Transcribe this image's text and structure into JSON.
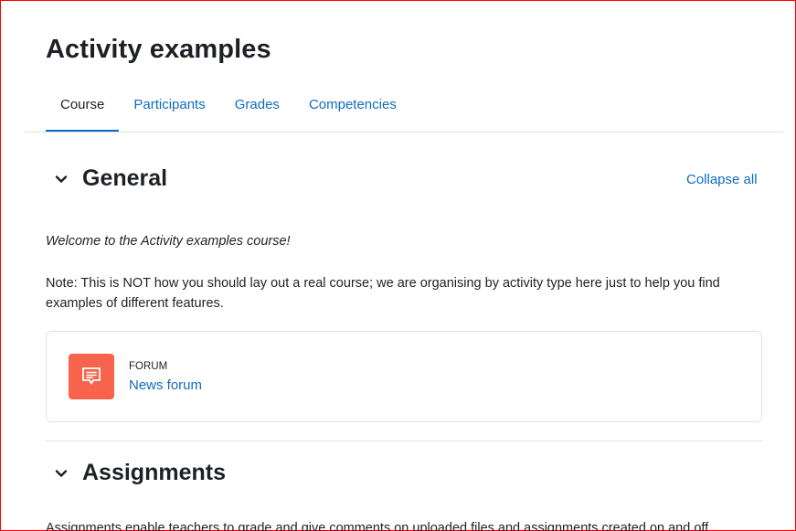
{
  "page": {
    "title": "Activity examples"
  },
  "tabs": [
    {
      "label": "Course",
      "active": true
    },
    {
      "label": "Participants",
      "active": false
    },
    {
      "label": "Grades",
      "active": false
    },
    {
      "label": "Competencies",
      "active": false
    }
  ],
  "controls": {
    "collapse_all": "Collapse all"
  },
  "sections": {
    "general": {
      "title": "General",
      "welcome": "Welcome to the Activity examples course!",
      "note": "Note: This is NOT how you should lay out a real course; we are organising by activity type here just to help you find examples of different features.",
      "activity": {
        "type": "FORUM",
        "name": "News forum",
        "icon": "forum-icon"
      }
    },
    "assignments": {
      "title": "Assignments",
      "cutoff_text": "Assignments enable teachers to grade and give comments on uploaded files and assignments created on and off"
    }
  },
  "colors": {
    "link": "#0f6cbf",
    "text": "#1d2125",
    "forum_icon_bg": "#f7634d",
    "border": "#dee2e6",
    "frame": "#ff0000"
  }
}
